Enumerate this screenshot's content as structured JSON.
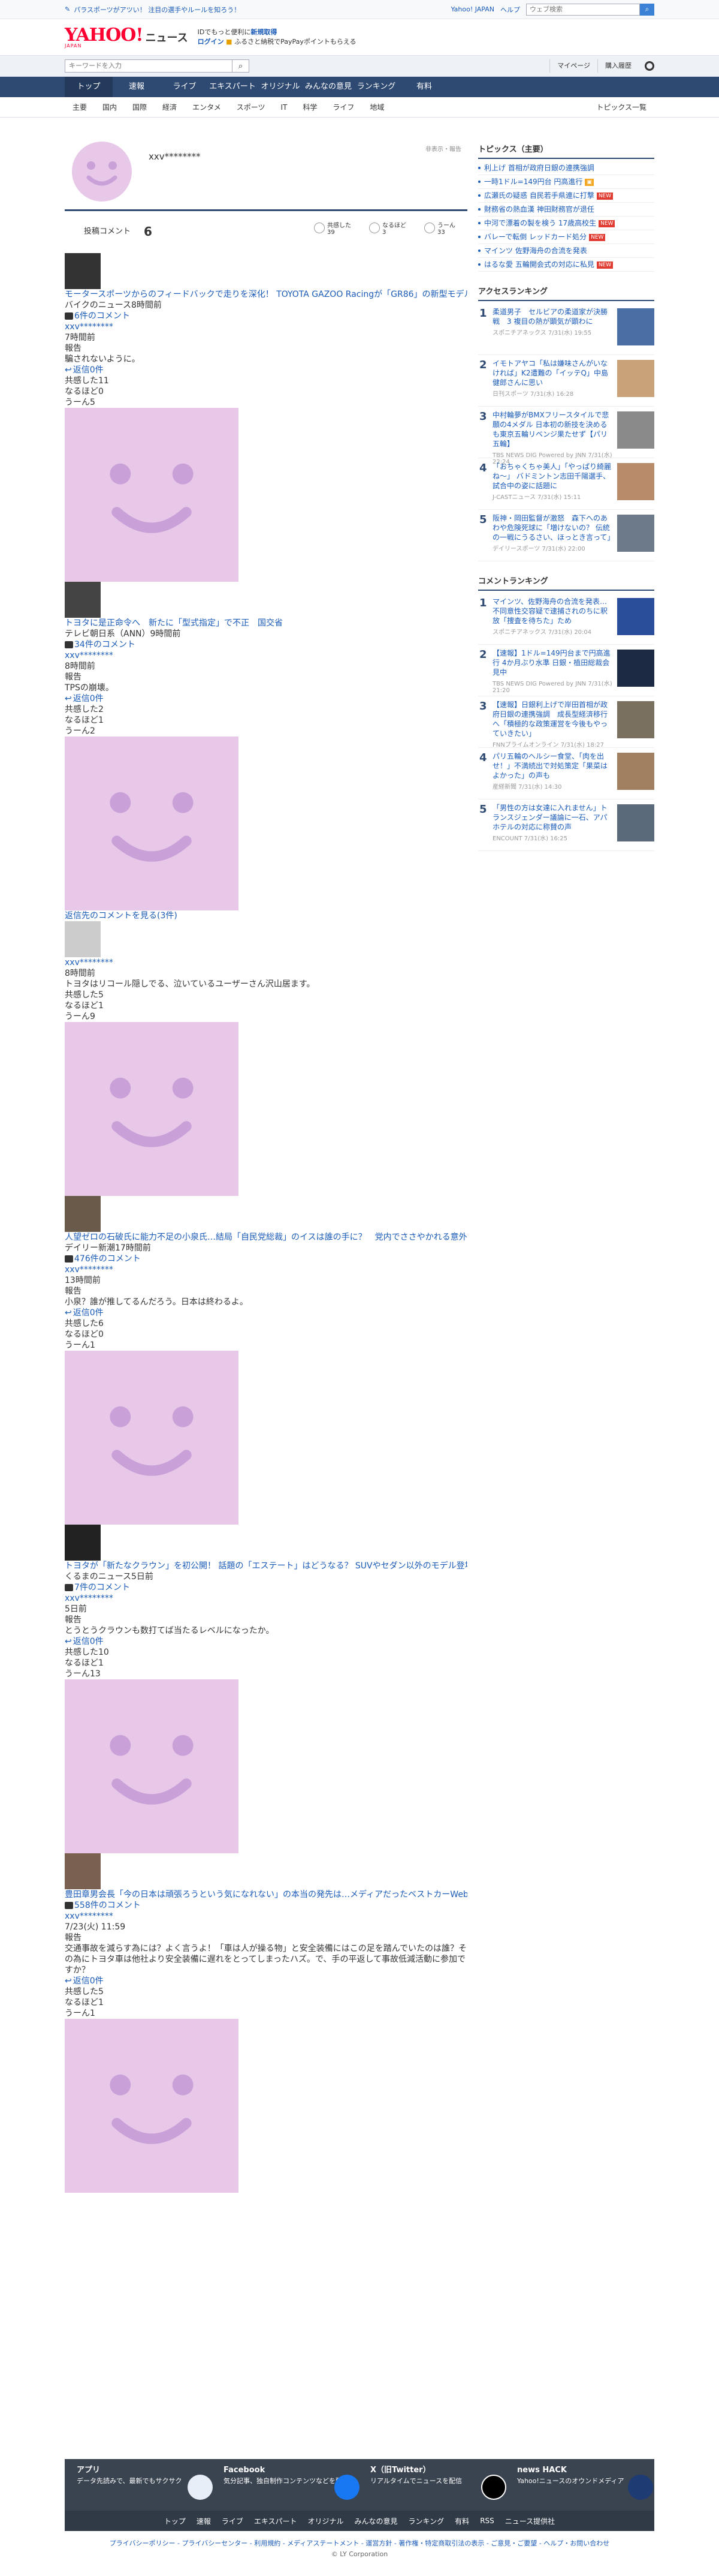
{
  "topbar": {
    "notice": "パラスポーツがアツい！ 注目の選手やルールを知ろう！",
    "links": [
      "Yahoo! JAPAN",
      "ヘルプ"
    ],
    "search_placeholder": "ウェブ検索"
  },
  "brand": {
    "logo": "YAHOO!",
    "logo_sub": "JAPAN",
    "site": "ニュース",
    "promo1": "IDでもっと便利に",
    "promo1_link": "新規取得",
    "promo2_link": "ログイン",
    "promo2": "ふるさと納税でPayPayポイントもらえる"
  },
  "searchbar": {
    "placeholder": "キーワードを入力",
    "links": [
      "マイページ",
      "購入履歴"
    ]
  },
  "mainnav": [
    "トップ",
    "速報",
    "ライブ",
    "エキスパート",
    "オリジナル",
    "みんなの意見",
    "ランキング",
    "有料"
  ],
  "subnav": [
    "主要",
    "国内",
    "国際",
    "経済",
    "エンタメ",
    "スポーツ",
    "IT",
    "科学",
    "ライフ",
    "地域"
  ],
  "subnav_more": "トピックス一覧",
  "profile": {
    "username": "xxv********",
    "flag": "非表示・報告",
    "post_label": "投稿コメント",
    "post_count": "6",
    "reacts": [
      {
        "label": "共感した",
        "count": "39"
      },
      {
        "label": "なるほど",
        "count": "3"
      },
      {
        "label": "うーん",
        "count": "33"
      }
    ]
  },
  "comments": [
    {
      "article": "モータースポーツからのフィードバックで走りを深化！ TOYOTA GAZOO Racingが「GR86」の新型モデルを発表",
      "source": "バイクのニュース8時間前",
      "comments": "6件のコメント",
      "user": "xxv********",
      "time": "7時間前",
      "report": "報告",
      "body": "騙されないように。",
      "replies": "返信0件",
      "empathy": "共感した11",
      "naruhodo": "なるほど0",
      "uun": "うーん5"
    },
    {
      "article": "トヨタに是正命令へ　新たに「型式指定」で不正　国交省",
      "source": "テレビ朝日系（ANN）9時間前",
      "comments": "34件のコメント",
      "user": "xxv********",
      "time": "8時間前",
      "report": "報告",
      "body": "TPSの崩壊。",
      "replies": "返信0件",
      "empathy": "共感した2",
      "naruhodo": "なるほど1",
      "uun": "うーん2",
      "more": "返信先のコメントを見る(3件)"
    },
    {
      "user": "xxv********",
      "time": "8時間前",
      "report": "報告",
      "body": "トヨタはリコール隠しでる、泣いているユーザーさん沢山居ます。",
      "empathy": "共感した5",
      "naruhodo": "なるほど1",
      "uun": "うーん9"
    },
    {
      "article": "人望ゼロの石破氏に能力不足の小泉氏…結局「自民党総裁」のイスは誰の手に？　党内でささやかれる意外な「有力候補」とは",
      "source": "デイリー新潮17時間前",
      "comments": "476件のコメント",
      "user": "xxv********",
      "time": "13時間前",
      "report": "報告",
      "body": "小泉？誰が推してるんだろう。日本は終わるよ。",
      "replies": "返信0件",
      "empathy": "共感した6",
      "naruhodo": "なるほど0",
      "uun": "うーん1"
    },
    {
      "article": "トヨタが「新たなクラウン」を初公開！ 話題の「エステート」はどうなる？ SUVやセダン以外のモデル登場は？ クラウン群の行方とは",
      "source": "くるまのニュース5日前",
      "comments": "7件のコメント",
      "user": "xxv********",
      "time": "5日前",
      "report": "報告",
      "body": "とうとうクラウンも数打てば当たるレベルになったか。",
      "replies": "返信0件",
      "empathy": "共感した10",
      "naruhodo": "なるほど1",
      "uun": "うーん13"
    },
    {
      "article": "豊田章男会長「今の日本は頑張ろうという気になれない」の本当の発先は…メディアだったベストカーWeb7/23(火) 10:49",
      "source": "",
      "comments": "558件のコメント",
      "user": "xxv********",
      "time": "7/23(火) 11:59",
      "report": "報告",
      "body": "交通事故を減らす為には？よく言うよ！「車は人が操る物」と安全装備にはこの足を踏んでいたのは誰？その為にトヨタ車は他社より安全装備に遅れをとってしまったハズ。で、手の平返して事故低減活動に参加ですか？",
      "replies": "返信0件",
      "empathy": "共感した5",
      "naruhodo": "なるほど1",
      "uun": "うーん1"
    }
  ],
  "sidebar": {
    "topics_title": "トピックス（主要）",
    "topics": [
      {
        "t": "利上げ 首相が政府日銀の連携強調",
        "tag": ""
      },
      {
        "t": "一時1ドル=149円台 円高進行",
        "tag": "new"
      },
      {
        "t": "広瀬氏の疑惑 自民若手県連に打撃",
        "tag": "new"
      },
      {
        "t": "財務省の熱血漢 神田財務官が退任",
        "tag": ""
      },
      {
        "t": "中河で漂着の製を検う 17歳高校生",
        "tag": "new"
      },
      {
        "t": "バレーで転倒 レッドカード処分",
        "tag": "new"
      },
      {
        "t": "マインツ 佐野海舟の合流を発表",
        "tag": ""
      },
      {
        "t": "はるな愛 五輪開会式の対応に私見",
        "tag": "new"
      }
    ],
    "access_title": "アクセスランキング",
    "access": [
      {
        "t": "柔道男子　セルビアの柔道家が決勝戦　3 複目の熱が顕気が顕わに",
        "m": "スポニチアネックス 7/31(水) 19:55"
      },
      {
        "t": "イモトアヤコ「私は嫌味さんがいなければ」K2遭難の「イッテQ」中島健郎さんに思い",
        "m": "日刊スポーツ 7/31(水) 16:28"
      },
      {
        "t": "中村輪夢がBMXフリースタイルで悲願の4メダル 日本初の新技を決めるも東京五輪リベンジ果たせず【パリ五輪】",
        "m": "TBS NEWS DIG Powered by JNN 7/31(水) 22:24"
      },
      {
        "t": "「おちゃくちゃ美人」「やっぱり綺麗ね〜」 バドミントン志田千陽選手、試合中の姿に話題に",
        "m": "J-CASTニュース 7/31(水) 15:11"
      },
      {
        "t": "阪神・岡田監督が激怒　森下へのあわや危険死球に「増けないの？ 伝統の一戦にうるさい、ほっとき言って」",
        "m": "デイリースポーツ 7/31(水) 22:00"
      }
    ],
    "comment_title": "コメントランキング",
    "commentrank": [
      {
        "t": "マインツ、佐野海舟の合流を発表…不同意性交容疑で逮捕されのちに釈放「捜査を待ちた」ため",
        "m": "スポニチアネックス 7/31(水) 20:04"
      },
      {
        "t": "【速報】1ドル=149円台まで円高進行 4か月ぶり水準 日銀・植田総裁会見中",
        "m": "TBS NEWS DIG Powered by JNN 7/31(水) 21:20"
      },
      {
        "t": "【速報】日銀利上げで岸田首相が政府日銀の連携強調　成長型経済移行へ「積極的な政策運営を今後もやっていきたい」",
        "m": "FNNプライムオンライン 7/31(水) 18:27"
      },
      {
        "t": "パリ五輪のヘルシー食堂、「肉を出せ！」不満続出で対処策定「果菜はよかった」の声も",
        "m": "産経新聞 7/31(水) 14:30"
      },
      {
        "t": "「男性の方は女達に入れません」トランスジェンダー議論に一石、アパホテルの対応に称賛の声",
        "m": "ENCOUNT 7/31(水) 16:25"
      }
    ]
  },
  "footer": {
    "cols": [
      {
        "title": "アプリ",
        "text": "データ先読みで、最新でもサクサク"
      },
      {
        "title": "Facebook",
        "text": "気分記事、独自制作コンテンツなどを配信"
      },
      {
        "title": "X（旧Twitter）",
        "text": "リアルタイムでニュースを配信"
      },
      {
        "title": "news HACK",
        "text": "Yahoo!ニュースのオウンドメディア"
      }
    ],
    "nav": [
      "トップ",
      "速報",
      "ライブ",
      "エキスパート",
      "オリジナル",
      "みんなの意見",
      "ランキング",
      "有料",
      "RSS",
      "ニュース提供社"
    ],
    "legal": "プライバシーポリシー - プライバシーセンター - 利用規約 - メディアステートメント - 運営方針 - 著作権・特定商取引法の表示 - ご意見・ご要望 - ヘルプ・お問い合わせ",
    "copyright": "© LY Corporation"
  }
}
